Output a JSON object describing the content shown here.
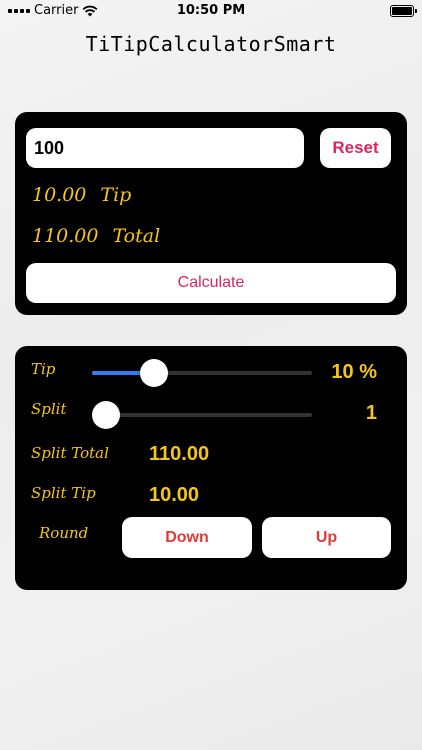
{
  "status": {
    "carrier": "Carrier",
    "time": "10:50 PM"
  },
  "title": "TiTipCalculatorSmart",
  "calculator": {
    "amount_value": "100",
    "reset_label": "Reset",
    "tip_value": "10.00",
    "tip_label": "Tip",
    "total_value": "110.00",
    "total_label": "Total",
    "calculate_label": "Calculate"
  },
  "settings": {
    "tip_label": "Tip",
    "tip_percent": "10 %",
    "tip_slider_fraction": 0.25,
    "split_label": "Split",
    "split_value": "1",
    "split_slider_fraction": 0.0,
    "split_total_label": "Split Total",
    "split_total_value": "110.00",
    "split_tip_label": "Split Tip",
    "split_tip_value": "10.00",
    "round_label": "Round",
    "round_down_label": "Down",
    "round_up_label": "Up"
  },
  "colors": {
    "accent": "#e0245e",
    "value_yellow": "#f5c518",
    "slider_blue": "#2f7bf5"
  },
  "icons": [
    "wifi-icon",
    "signal-icon",
    "battery-icon"
  ]
}
